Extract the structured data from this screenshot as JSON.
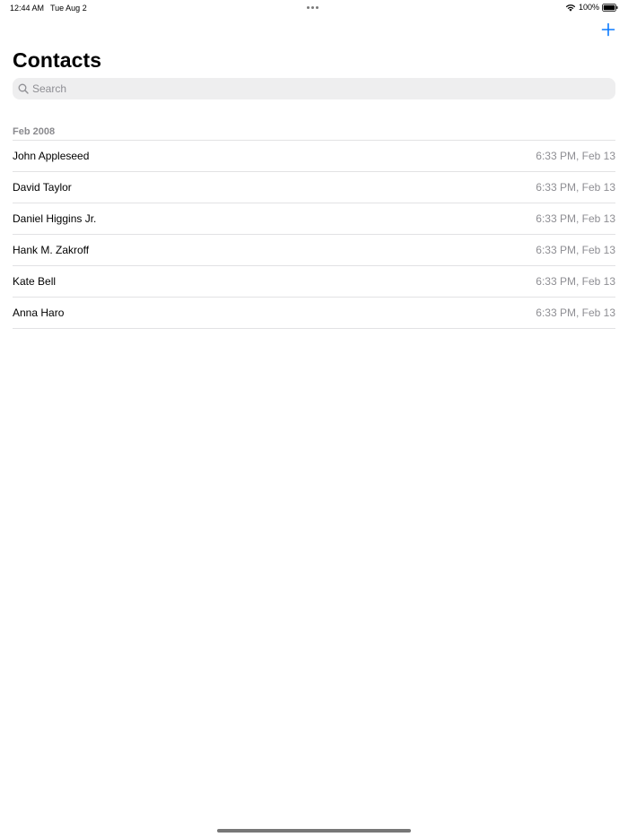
{
  "status_bar": {
    "time": "12:44 AM",
    "date": "Tue Aug 2",
    "battery": "100%"
  },
  "nav": {
    "title": "Contacts",
    "add_icon": "plus-icon"
  },
  "search": {
    "placeholder": "Search",
    "value": ""
  },
  "section": {
    "header": "Feb 2008",
    "items": [
      {
        "name": "John Appleseed",
        "time": "6:33 PM, Feb 13"
      },
      {
        "name": "David Taylor",
        "time": "6:33 PM, Feb 13"
      },
      {
        "name": "Daniel Higgins Jr.",
        "time": "6:33 PM, Feb 13"
      },
      {
        "name": "Hank M. Zakroff",
        "time": "6:33 PM, Feb 13"
      },
      {
        "name": "Kate Bell",
        "time": "6:33 PM, Feb 13"
      },
      {
        "name": "Anna Haro",
        "time": "6:33 PM, Feb 13"
      }
    ]
  },
  "colors": {
    "accent": "#0a7aff",
    "secondary_text": "#8e8e93",
    "search_bg": "#eeeeef",
    "separator": "#e2e2e4"
  }
}
